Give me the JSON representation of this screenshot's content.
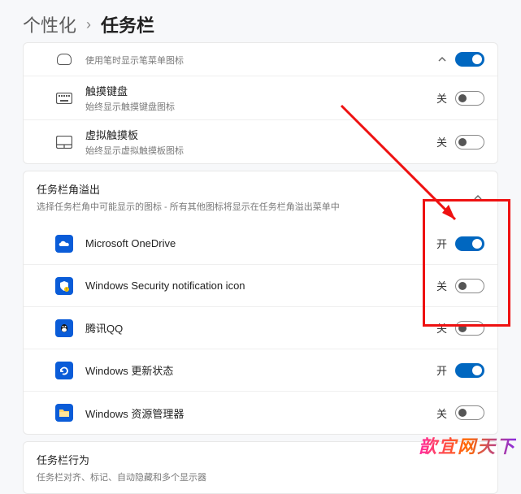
{
  "breadcrumb": {
    "parent": "个性化",
    "sep": "›",
    "current": "任务栏"
  },
  "top_rows": [
    {
      "icon": "pen",
      "title": "",
      "subtitle": "使用笔时显示笔菜单图标",
      "state": "",
      "on": true,
      "show_toggle": true,
      "show_chevron": true
    },
    {
      "icon": "keyboard",
      "title": "触摸键盘",
      "subtitle": "始终显示触摸键盘图标",
      "state": "关",
      "on": false,
      "show_toggle": true,
      "show_chevron": false
    },
    {
      "icon": "touchpad",
      "title": "虚拟触摸板",
      "subtitle": "始终显示虚拟触摸板图标",
      "state": "关",
      "on": false,
      "show_toggle": true,
      "show_chevron": false
    }
  ],
  "overflow_section": {
    "title": "任务栏角溢出",
    "subtitle": "选择任务栏角中可能显示的图标 - 所有其他图标将显示在任务栏角溢出菜单中",
    "items": [
      {
        "icon": "onedrive",
        "color": "#0a5cd8",
        "label": "Microsoft OneDrive",
        "state": "开",
        "on": true
      },
      {
        "icon": "security",
        "color": "#0a5cd8",
        "label": "Windows Security notification icon",
        "state": "关",
        "on": false
      },
      {
        "icon": "qq",
        "color": "#0a5cd8",
        "label": "腾讯QQ",
        "state": "关",
        "on": false
      },
      {
        "icon": "update",
        "color": "#0a5cd8",
        "label": "Windows 更新状态",
        "state": "开",
        "on": true
      },
      {
        "icon": "explorer",
        "color": "#0a5cd8",
        "label": "Windows 资源管理器",
        "state": "关",
        "on": false
      }
    ]
  },
  "behavior_section": {
    "title": "任务栏行为",
    "subtitle": "任务栏对齐、标记、自动隐藏和多个显示器"
  },
  "watermark": "歆宜网天下"
}
